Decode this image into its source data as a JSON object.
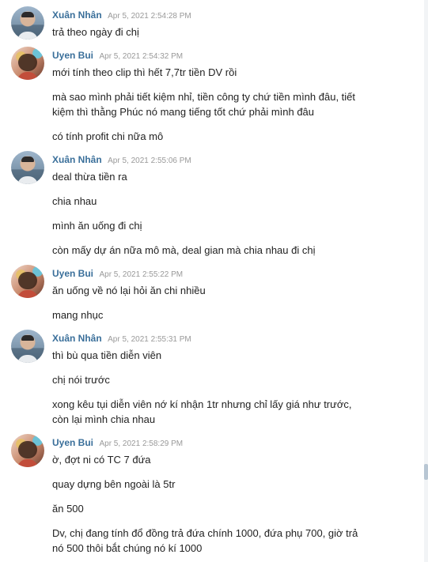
{
  "messages": [
    {
      "sender": "Xuân Nhân",
      "time": "Apr 5, 2021 2:54:28 PM",
      "avatar": "xuan",
      "lines": [
        "trả theo ngày đi chị"
      ]
    },
    {
      "sender": "Uyen Bui",
      "time": "Apr 5, 2021 2:54:32 PM",
      "avatar": "uyen",
      "lines": [
        "mới tính theo clip thì hết 7,7tr tiền DV rồi",
        "mà sao mình phải tiết kiệm nhỉ, tiền công ty chứ tiền mình đâu, tiết kiệm thì thằng Phúc nó mang tiếng tốt chứ phải mình đâu",
        "có tính profit chi nữa mô"
      ]
    },
    {
      "sender": "Xuân Nhân",
      "time": "Apr 5, 2021 2:55:06 PM",
      "avatar": "xuan",
      "lines": [
        "deal thừa tiền ra",
        "chia nhau",
        "mình ăn uống đi chị",
        "còn mấy dự án nữa mô mà, deal gian mà chia nhau đi chị"
      ]
    },
    {
      "sender": "Uyen Bui",
      "time": "Apr 5, 2021 2:55:22 PM",
      "avatar": "uyen",
      "lines": [
        "ăn uống về nó lại hỏi ăn chi nhiều",
        "mang nhục"
      ]
    },
    {
      "sender": "Xuân Nhân",
      "time": "Apr 5, 2021 2:55:31 PM",
      "avatar": "xuan",
      "lines": [
        "thì bù qua tiền diễn viên",
        "chị nói trước",
        "xong kêu tụi diễn viên nớ kí nhận 1tr nhưng chỉ lấy giá như trước, còn lại mình chia nhau"
      ]
    },
    {
      "sender": "Uyen Bui",
      "time": "Apr 5, 2021 2:58:29 PM",
      "avatar": "uyen",
      "lines": [
        "ờ, đợt ni có TC 7 đứa",
        "quay dựng bên ngoài là 5tr",
        "ăn 500",
        "Dv, chị đang tính đổ đồng trả đứa chính 1000, đứa phụ 700, giờ trả nó 500 thôi bắt chúng nó kí 1000"
      ]
    }
  ]
}
